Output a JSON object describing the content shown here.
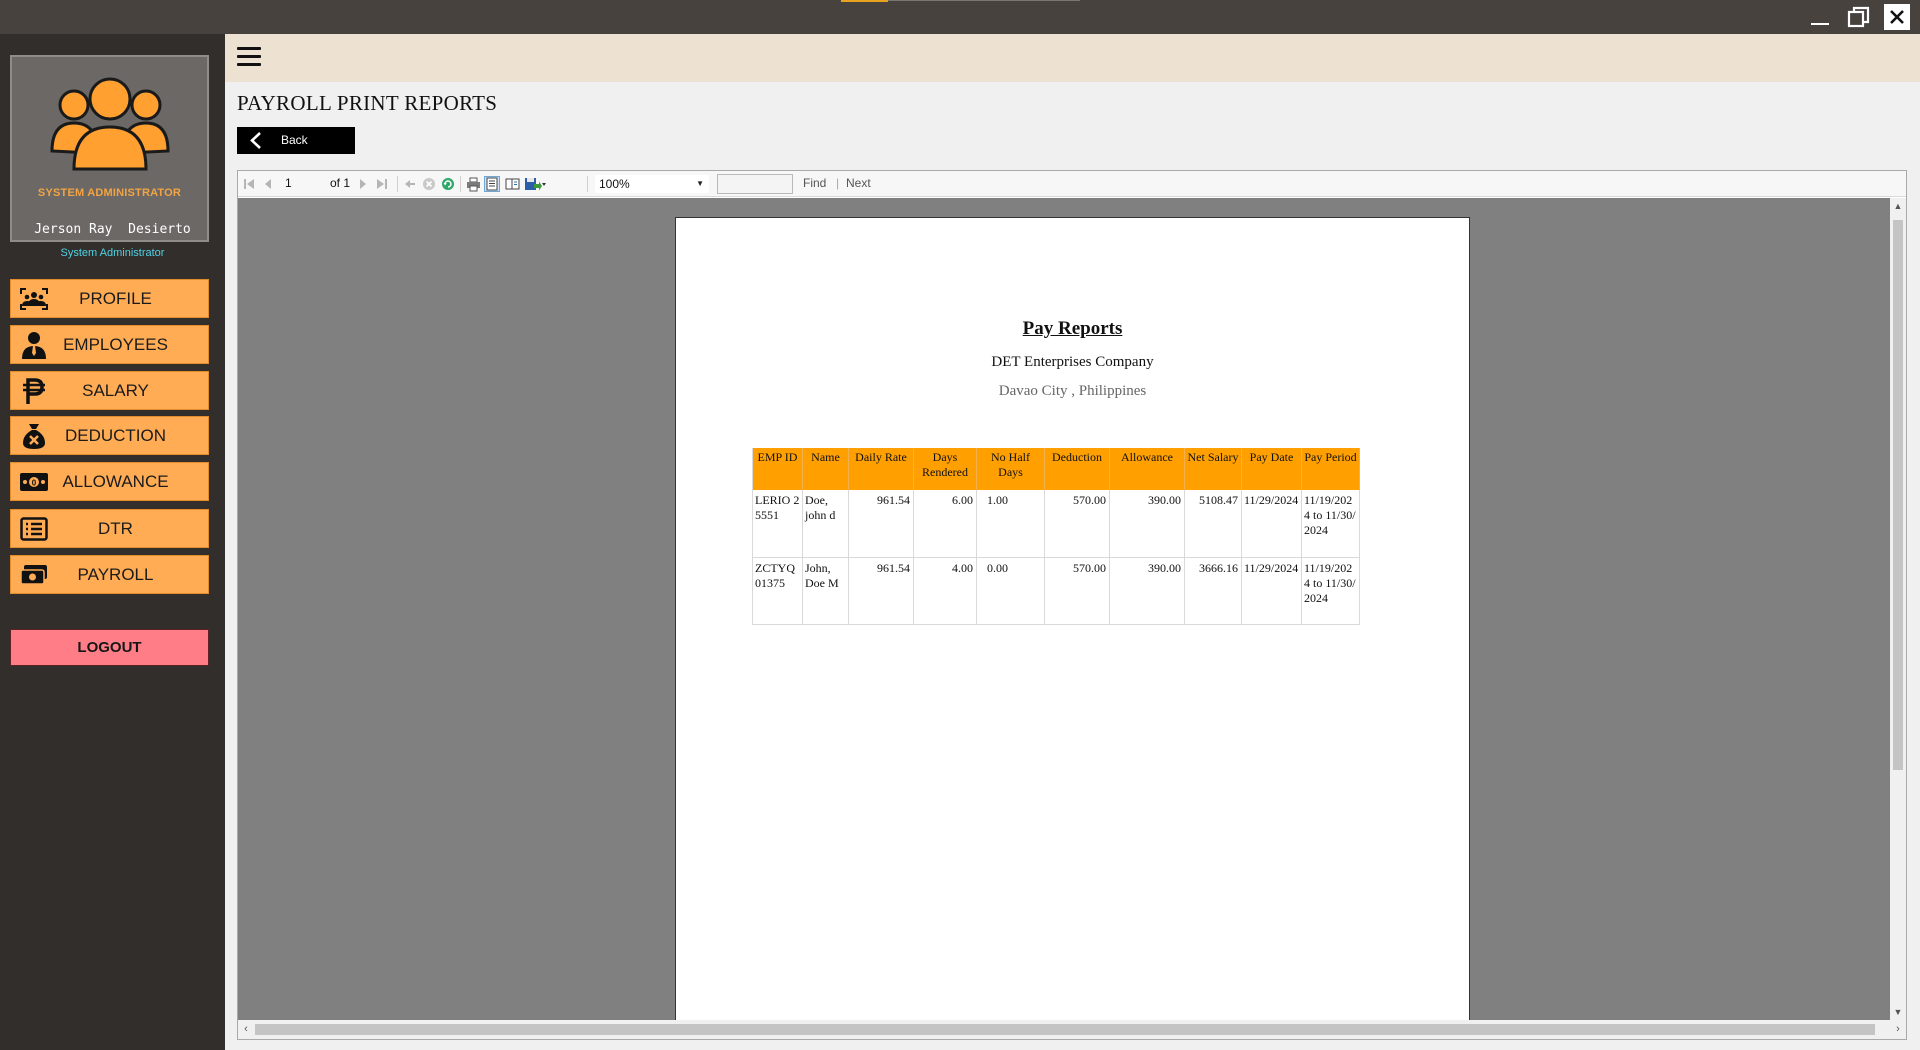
{
  "window": {
    "minimize_icon": "minimize-icon",
    "restore_icon": "restore-icon",
    "close_icon": "close-icon"
  },
  "sidebar": {
    "avatar_role": "SYSTEM ADMINISTRATOR",
    "user_name": "Jerson Ray  Desierto",
    "user_role": "System Administrator",
    "items": [
      {
        "label": "PROFILE",
        "icon": "users-scan-icon"
      },
      {
        "label": "EMPLOYEES",
        "icon": "employee-icon"
      },
      {
        "label": "SALARY",
        "icon": "peso-icon"
      },
      {
        "label": "DEDUCTION",
        "icon": "money-bag-x-icon"
      },
      {
        "label": "ALLOWANCE",
        "icon": "cash-icon"
      },
      {
        "label": "DTR",
        "icon": "list-icon"
      },
      {
        "label": "PAYROLL",
        "icon": "payroll-cash-icon"
      }
    ],
    "logout_label": "LOGOUT",
    "accent_color": "#ffac54",
    "logout_color": "#ff7d86"
  },
  "header": {
    "menu_icon": "hamburger-icon"
  },
  "main": {
    "title": "PAYROLL PRINT REPORTS",
    "back_label": "Back"
  },
  "viewer": {
    "toolbar": {
      "page_current": "1",
      "page_total": "of 1",
      "zoom": "100%",
      "find_label": "Find",
      "next_label": "Next",
      "search_value": ""
    },
    "report": {
      "title": "Pay Reports",
      "company": "DET Enterprises Company",
      "location": "Davao City , Philippines",
      "columns": [
        "EMP ID",
        "Name",
        "Daily Rate",
        "Days Rendered",
        "No Half Days",
        "Deduction",
        "Allowance",
        "Net Salary",
        "Pay Date",
        "Pay Period"
      ],
      "rows": [
        [
          "LERIO 25551",
          "Doe, john d",
          "961.54",
          "6.00",
          "1.00",
          "570.00",
          "390.00",
          "5108.47",
          "11/29/2024",
          "11/19/2024 to 11/30/2024"
        ],
        [
          "ZCTYQ 01375",
          "John, Doe M",
          "961.54",
          "4.00",
          "0.00",
          "570.00",
          "390.00",
          "3666.16",
          "11/29/2024",
          "11/19/2024 to 11/30/2024"
        ]
      ],
      "header_color": "#ffa000"
    }
  }
}
